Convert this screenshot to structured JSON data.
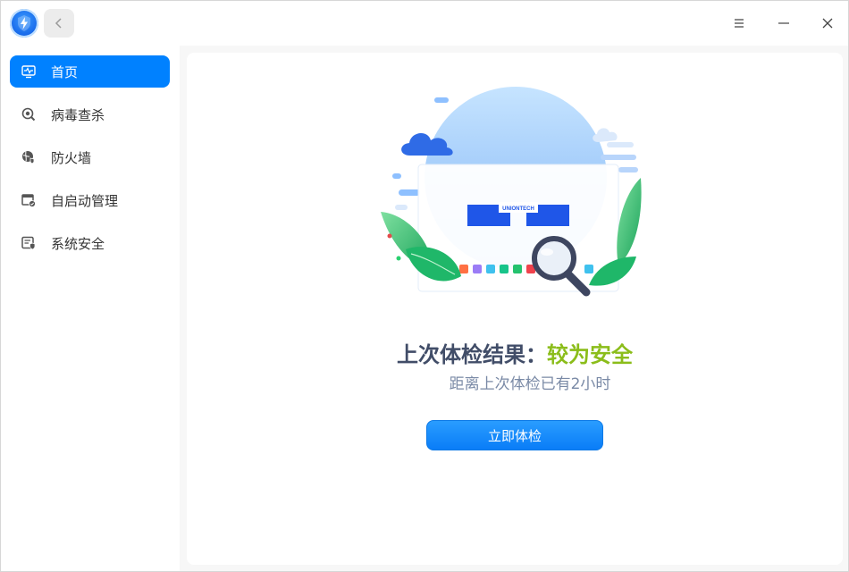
{
  "window": {
    "app_icon": "defender-lightning-icon"
  },
  "titlebar": {
    "back_icon": "chevron-left-icon",
    "menu_icon": "hamburger-menu-icon",
    "minimize_icon": "minimize-icon",
    "close_icon": "close-icon"
  },
  "sidebar": {
    "items": [
      {
        "label": "首页",
        "icon": "monitor-pulse-icon",
        "active": true
      },
      {
        "label": "病毒查杀",
        "icon": "virus-scan-icon",
        "active": false
      },
      {
        "label": "防火墙",
        "icon": "firewall-globe-icon",
        "active": false
      },
      {
        "label": "自启动管理",
        "icon": "startup-window-icon",
        "active": false
      },
      {
        "label": "系统安全",
        "icon": "system-security-icon",
        "active": false
      }
    ]
  },
  "main": {
    "result_prefix": "上次体检结果：",
    "result_status": "较为安全",
    "last_check": "距离上次体检已有2小时",
    "check_button": "立即体检",
    "illustration_brand": "UNIONTECH"
  },
  "colors": {
    "accent": "#0081ff",
    "safe_status": "#8bbd1a",
    "heading": "#414d68"
  }
}
